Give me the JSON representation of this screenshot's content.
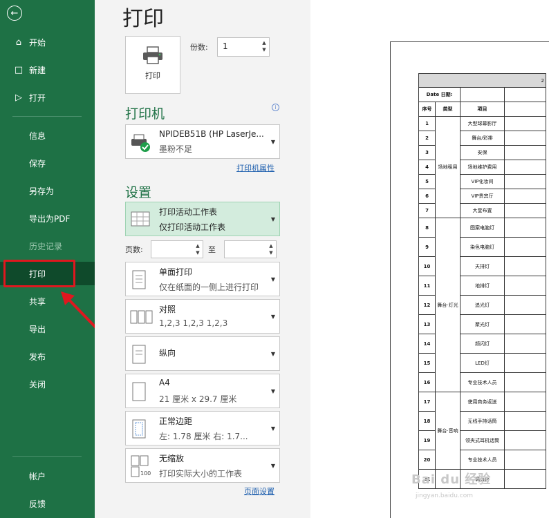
{
  "sidebar": {
    "back_icon": "back-arrow-icon",
    "items": [
      {
        "label": "开始",
        "icon": "home-icon"
      },
      {
        "label": "新建",
        "icon": "new-document-icon"
      },
      {
        "label": "打开",
        "icon": "open-folder-icon"
      },
      {
        "label": "信息"
      },
      {
        "label": "保存"
      },
      {
        "label": "另存为"
      },
      {
        "label": "导出为PDF"
      },
      {
        "label": "历史记录"
      },
      {
        "label": "打印"
      },
      {
        "label": "共享"
      },
      {
        "label": "导出"
      },
      {
        "label": "发布"
      },
      {
        "label": "关闭"
      },
      {
        "label": "帐户"
      },
      {
        "label": "反馈"
      }
    ],
    "selected": "打印",
    "color": "#1e7145"
  },
  "main": {
    "title": "打印",
    "print_button": "打印",
    "copies_label": "份数:",
    "copies_value": "1",
    "printer_section": "打印机",
    "printer_name": "NPIDEB51B (HP LaserJe...",
    "printer_status": "墨粉不足",
    "printer_properties": "打印机属性",
    "settings_section": "设置",
    "settings": [
      {
        "line1": "打印活动工作表",
        "line2": "仅打印活动工作表",
        "icon": "sheet-grid-icon"
      },
      {
        "line1": "单面打印",
        "line2": "仅在纸面的一侧上进行打印",
        "icon": "single-sided-icon"
      },
      {
        "line1": "对照",
        "line2": "1,2,3    1,2,3    1,2,3",
        "icon": "collate-icon"
      },
      {
        "line1": "纵向",
        "line2": "",
        "icon": "portrait-icon"
      },
      {
        "line1": "A4",
        "line2": "21 厘米 x 29.7 厘米",
        "icon": "paper-size-icon"
      },
      {
        "line1": "正常边距",
        "line2": "左: 1.78 厘米    右: 1.7...",
        "icon": "margins-icon"
      },
      {
        "line1": "无缩放",
        "line2": "打印实际大小的工作表",
        "icon": "no-scaling-icon"
      }
    ],
    "pages_label": "页数:",
    "to_label": "至",
    "page_setup": "页面设置",
    "accent": "#1e7145"
  },
  "preview": {
    "title_partial": "2",
    "date_label": "Date  日期:",
    "headers": [
      "序号",
      "类型",
      "项目"
    ],
    "rows": [
      {
        "no": "1",
        "item": "大型球幕影厅"
      },
      {
        "no": "2",
        "item": "舞台/彩排"
      },
      {
        "no": "3",
        "item": "安保"
      },
      {
        "no": "4",
        "item": "场地维护费用"
      },
      {
        "no": "5",
        "item": "VIP化妆间"
      },
      {
        "no": "6",
        "item": "VIP贵宾厅"
      },
      {
        "no": "7",
        "item": "大堂布置"
      },
      {
        "no": "8",
        "item": "图案电脑灯"
      },
      {
        "no": "9",
        "item": "染色电脑灯"
      },
      {
        "no": "10",
        "item": "天排灯"
      },
      {
        "no": "11",
        "item": "地排灯"
      },
      {
        "no": "12",
        "item": "追光灯"
      },
      {
        "no": "13",
        "item": "聚光灯"
      },
      {
        "no": "14",
        "item": "频闪灯"
      },
      {
        "no": "15",
        "item": "LED灯"
      },
      {
        "no": "16",
        "item": "专业技术人员"
      },
      {
        "no": "17",
        "item": "使用商务返送"
      },
      {
        "no": "18",
        "item": "无线手持话筒"
      },
      {
        "no": "19",
        "item": "领夹式耳机话筒"
      },
      {
        "no": "20",
        "item": "专业技术人员"
      },
      {
        "no": "21",
        "item": "调音台"
      }
    ],
    "group1": "场地租用",
    "group2": "舞台·灯光",
    "group3": "舞台·音响",
    "watermark": "Bai du 经验",
    "watermark_url": "jingyan.baidu.com"
  }
}
